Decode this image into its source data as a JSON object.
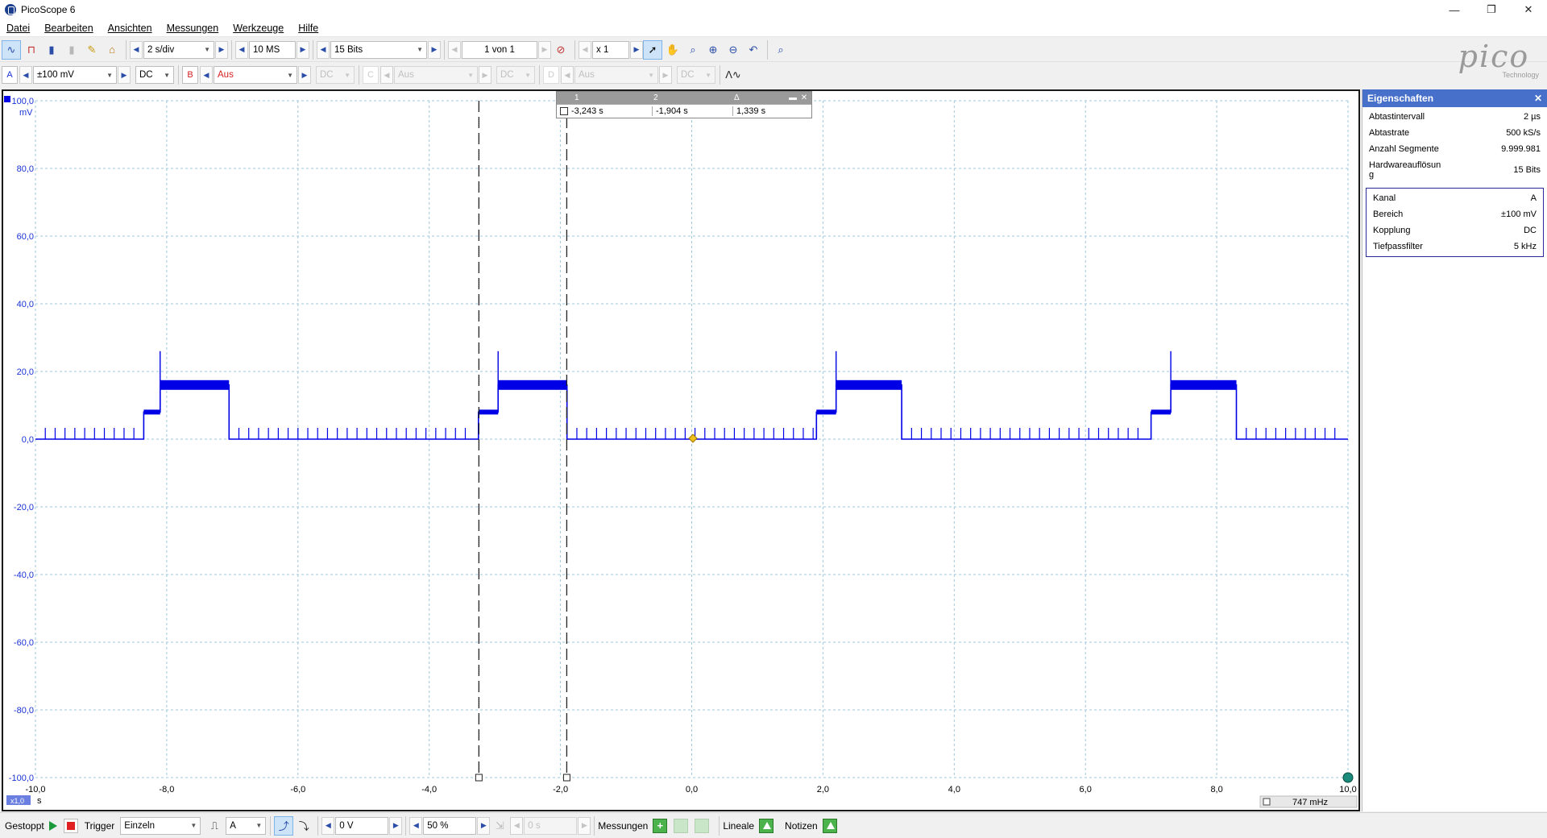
{
  "window": {
    "title": "PicoScope 6",
    "minimize": "—",
    "restore": "❐",
    "close": "✕"
  },
  "menu": [
    "Datei",
    "Bearbeiten",
    "Ansichten",
    "Messungen",
    "Werkzeuge",
    "Hilfe"
  ],
  "toolbar": {
    "timebase": "2 s/div",
    "samples": "10 MS",
    "resolution": "15 Bits",
    "buffer": "1 von 1",
    "zoom": "x 1"
  },
  "channels": {
    "a": {
      "label": "A",
      "range": "±100 mV",
      "coupling": "DC"
    },
    "b": {
      "label": "B",
      "range": "Aus",
      "coupling": "DC"
    },
    "c": {
      "label": "C",
      "range": "Aus",
      "coupling": "DC"
    },
    "d": {
      "label": "D",
      "range": "Aus",
      "coupling": "DC"
    }
  },
  "logo": {
    "word": "pico",
    "sub": "Technology"
  },
  "scope": {
    "y_unit": "mV",
    "x_unit": "s",
    "x_scale_badge": "x1,0",
    "y_ticks": [
      "100,0",
      "80,0",
      "60,0",
      "40,0",
      "20,0",
      "0,0",
      "-20,0",
      "-40,0",
      "-60,0",
      "-80,0",
      "-100,0"
    ],
    "x_ticks": [
      "-10,0",
      "-8,0",
      "-6,0",
      "-4,0",
      "-2,0",
      "0,0",
      "2,0",
      "4,0",
      "6,0",
      "8,0",
      "10,0"
    ],
    "rulers": {
      "headers": [
        "1",
        "2",
        "Δ"
      ],
      "values": [
        "-3,243 s",
        "-1,904 s",
        "1,339 s"
      ]
    },
    "frequency_readout": "747 mHz"
  },
  "chart_data": {
    "type": "line",
    "title": "",
    "xlabel": "s",
    "ylabel": "mV",
    "xlim": [
      -10,
      10
    ],
    "ylim": [
      -100,
      100
    ],
    "grid": true,
    "series": [
      {
        "name": "A",
        "color": "#0000e6",
        "x": [
          -10,
          -8.35,
          -8.35,
          -8.1,
          -8.1,
          -7.05,
          -7.05,
          -3.25,
          -3.25,
          -2.95,
          -2.95,
          -1.9,
          -1.9,
          1.9,
          1.9,
          2.2,
          2.2,
          3.2,
          3.2,
          7.0,
          7.0,
          7.3,
          7.3,
          8.3,
          8.3,
          10
        ],
        "y": [
          0,
          0,
          8,
          8,
          16,
          16,
          0,
          0,
          8,
          8,
          16,
          16,
          0,
          0,
          8,
          8,
          16,
          16,
          0,
          0,
          8,
          8,
          16,
          16,
          0,
          0
        ]
      }
    ],
    "vertical_rulers": [
      -3.243,
      -1.904
    ]
  },
  "properties": {
    "title": "Eigenschaften",
    "rows": [
      {
        "label": "Abtastintervall",
        "value": "2 µs"
      },
      {
        "label": "Abtastrate",
        "value": "500 kS/s"
      },
      {
        "label": "Anzahl Segmente",
        "value": "9.999.981"
      },
      {
        "label": "Hardwareauflösun g",
        "value": "15 Bits"
      }
    ],
    "channel_rows": [
      {
        "label": "Kanal",
        "value": "A"
      },
      {
        "label": "Bereich",
        "value": "±100 mV"
      },
      {
        "label": "Kopplung",
        "value": "DC"
      },
      {
        "label": "Tiefpassfilter",
        "value": "5 kHz"
      }
    ]
  },
  "status": {
    "state": "Gestoppt",
    "trigger_label": "Trigger",
    "trigger_mode": "Einzeln",
    "trigger_channel": "A",
    "trigger_level": "0 V",
    "pretrigger": "50 %",
    "delay": "0 s",
    "measurements": "Messungen",
    "rulers": "Lineale",
    "notes": "Notizen"
  }
}
